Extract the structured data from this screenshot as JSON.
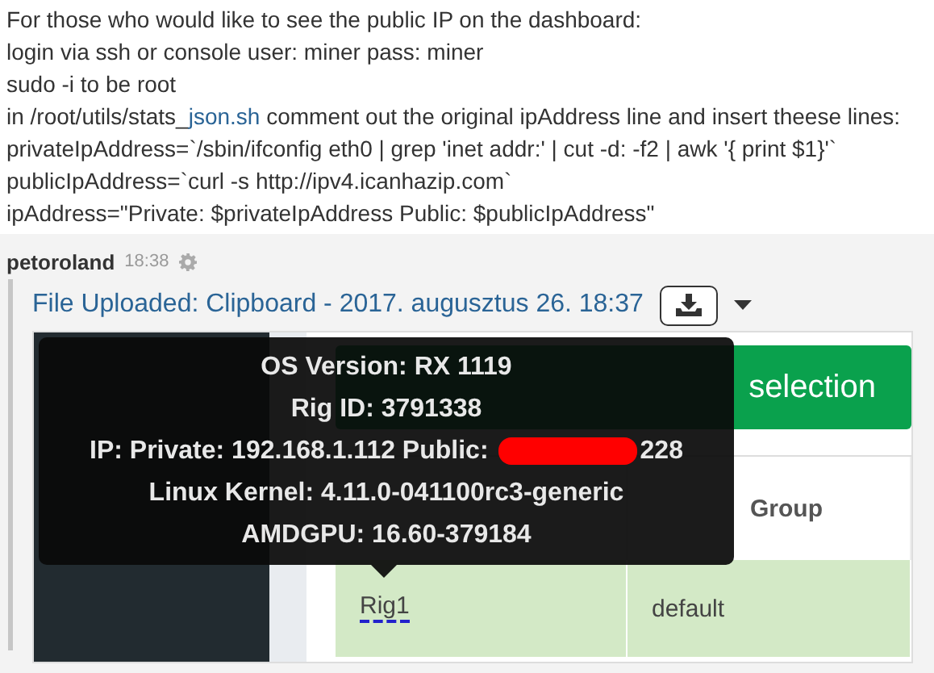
{
  "post_text": {
    "lines": [
      {
        "text": "For those who would like to see the public IP on the dashboard:"
      },
      {
        "text": "login via ssh or console user: miner pass: miner"
      },
      {
        "text": "sudo -i to be root"
      },
      {
        "text": "in /root/utils/stats_",
        "link": "json.sh",
        "after": " comment out the original ipAddress line and insert theese lines:"
      },
      {
        "text": "privateIpAddress=`/sbin/ifconfig eth0 | grep 'inet addr:' | cut -d: -f2 | awk '{ print $1}'`"
      },
      {
        "text": "publicIpAddress=`curl -s http://ipv4.icanhazip.com`"
      },
      {
        "text": "ipAddress=\"Private: $privateIpAddress Public: $publicIpAddress\""
      }
    ]
  },
  "message": {
    "author": "petoroland",
    "time": "18:38",
    "attachment": {
      "title": "File Uploaded: Clipboard - 2017. augusztus 26. 18:37",
      "image": {
        "button_label": "selection",
        "column_2": "Group",
        "rows": [
          {
            "cells": [
              "Rig1",
              "default"
            ]
          }
        ],
        "tooltip": {
          "lines": [
            {
              "text": "OS Version: RX 1119"
            },
            {
              "text": "Rig ID: 3791338"
            },
            {
              "text": "IP: Private: 192.168.1.112 Public:",
              "redacted": true,
              "tail": "228"
            },
            {
              "text": "Linux Kernel: 4.11.0-041100rc3-generic"
            },
            {
              "text": "AMDGPU: 16.60-379184"
            }
          ]
        }
      }
    }
  }
}
